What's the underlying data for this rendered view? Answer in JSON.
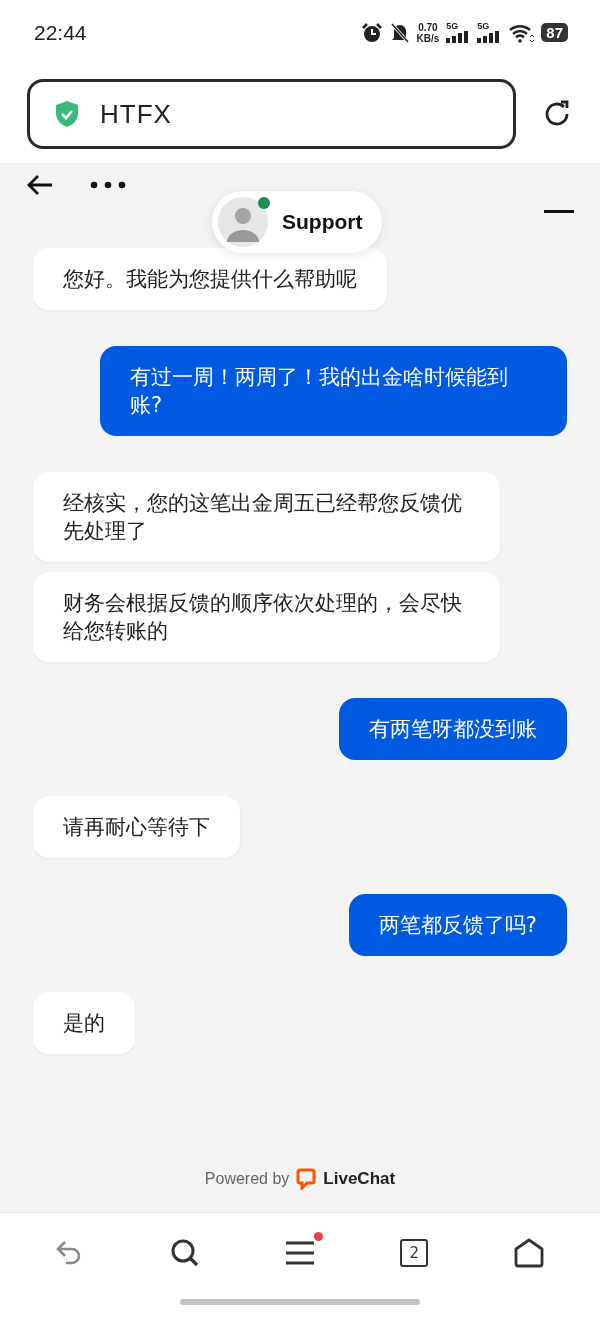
{
  "status_bar": {
    "time": "22:44",
    "speed_value": "0.70",
    "speed_unit": "KB/s",
    "networks": [
      "5G",
      "5G"
    ],
    "battery": "87"
  },
  "address_bar": {
    "secure": true,
    "url": "HTFX"
  },
  "chat_header": {
    "agent_name": "Support",
    "agent_online": true
  },
  "messages": [
    {
      "kind": "agent",
      "text": "您好。我能为您提供什么帮助呢"
    },
    {
      "kind": "visitor",
      "text": "有过一周！两周了！我的出金啥时候能到账?"
    },
    {
      "kind": "agent",
      "text": "经核实，您的这笔出金周五已经帮您反馈优先处理了"
    },
    {
      "kind": "agent",
      "text": "财务会根据反馈的顺序依次处理的，会尽快给您转账的"
    },
    {
      "kind": "visitor",
      "text": "有两笔呀都没到账"
    },
    {
      "kind": "agent",
      "text": "请再耐心等待下"
    },
    {
      "kind": "visitor",
      "text": "两笔都反馈了吗?"
    },
    {
      "kind": "agent",
      "text": "是的"
    }
  ],
  "footer": {
    "powered_by": "Powered by",
    "brand": "LiveChat"
  },
  "bottom_nav": {
    "back_disabled": true,
    "menu_notification": true,
    "tab_count": "2"
  }
}
